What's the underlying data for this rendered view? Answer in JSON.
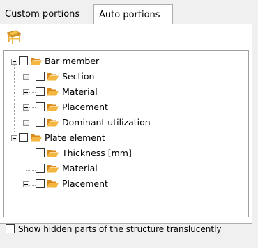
{
  "tabs": {
    "custom": "Custom portions",
    "auto": "Auto portions"
  },
  "toolbar": {
    "icon": "furniture-table-icon"
  },
  "tree": {
    "bar_member": {
      "label": "Bar member",
      "expanded": true,
      "children": [
        "Section",
        "Material",
        "Placement",
        "Dominant utilization"
      ]
    },
    "plate_element": {
      "label": "Plate element",
      "expanded": true,
      "children": [
        "Thickness [mm]",
        "Material",
        "Placement"
      ]
    }
  },
  "options": {
    "show_hidden": "Show hidden parts of the structure translucently",
    "show_hidden_checked": false
  },
  "colors": {
    "folder": "#f4b63f",
    "folder_dark": "#d98a1c"
  }
}
